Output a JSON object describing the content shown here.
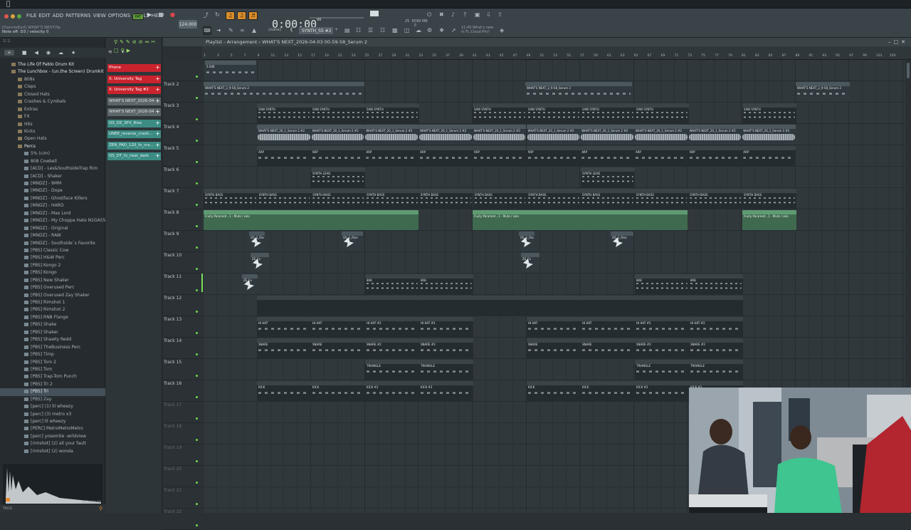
{
  "menu": [
    "FILE",
    "EDIT",
    "ADD",
    "PATTERNS",
    "VIEW",
    "OPTIONS",
    "TOOLS",
    "HELP"
  ],
  "hint": {
    "project": "[DannieEarl] WHAT'S NEXT.flp",
    "status": "Note off: D3 / velocity 0"
  },
  "transport": {
    "mode": "PAT",
    "tempo": "124.000",
    "time": "0:00:00",
    "time_small": "00"
  },
  "monitor": {
    "cpu": "25",
    "ram": "6599 MB",
    "voices": "0"
  },
  "pattern_selector": "SYNTH_SS #2",
  "snap": "(none)",
  "news": {
    "line1": "11:45 What's new",
    "line2": "in FL Cloud Pro?"
  },
  "playlist": {
    "title": "Playlist - Arrangement",
    "breadcrumb": "WHAT'S NEXT_2026-04-03 00-59-58_Serum 2"
  },
  "browser": {
    "items": [
      {
        "label": "The Life Of Pablo Drum Kit",
        "level": 0,
        "bold": true
      },
      {
        "label": "The Lunchbox - (un.the Screen) Drumkit",
        "level": 0,
        "bold": true
      },
      {
        "label": "808s",
        "level": 1
      },
      {
        "label": "Claps",
        "level": 1
      },
      {
        "label": "Closed Hats",
        "level": 1
      },
      {
        "label": "Crashes & Cymbals",
        "level": 1
      },
      {
        "label": "Extras",
        "level": 1
      },
      {
        "label": "FX",
        "level": 1
      },
      {
        "label": "Hits",
        "level": 1
      },
      {
        "label": "Kicks",
        "level": 1
      },
      {
        "label": "Open Hats",
        "level": 1
      },
      {
        "label": "Percs",
        "level": 1,
        "bold": true
      },
      {
        "label": "5% (cim)",
        "level": 2
      },
      {
        "label": "808 Cowbell",
        "level": 2
      },
      {
        "label": "[ACD] - Les&SouthsideTrap Rim",
        "level": 2
      },
      {
        "label": "[ACD] - Shaker",
        "level": 2
      },
      {
        "label": "[MNDZ] - 9MM",
        "level": 2
      },
      {
        "label": "[MNDZ] - Dope",
        "level": 2
      },
      {
        "label": "[MNDZ] - Ghostface Killers",
        "level": 2
      },
      {
        "label": "[MNDZ] - HARD",
        "level": 2
      },
      {
        "label": "[MNDZ] - Max Lord",
        "level": 2
      },
      {
        "label": "[MNDZ] - My Choppa Hate N1GA55",
        "level": 2
      },
      {
        "label": "[MNDZ] - Original",
        "level": 2
      },
      {
        "label": "[MNDZ] - RAW",
        "level": 2
      },
      {
        "label": "[MNDZ] - Southside`s Favorite",
        "level": 2
      },
      {
        "label": "[PBS] Classic Cow",
        "level": 2
      },
      {
        "label": "[PBS] H&W Perc",
        "level": 2
      },
      {
        "label": "[PBS] Kongo 2",
        "level": 2
      },
      {
        "label": "[PBS] Kongo",
        "level": 2
      },
      {
        "label": "[PBS] New Shaker",
        "level": 2
      },
      {
        "label": "[PBS] Overused Perc",
        "level": 2
      },
      {
        "label": "[PBS] Overused Zay Shaker",
        "level": 2
      },
      {
        "label": "[PBS] Rimshot 1",
        "level": 2
      },
      {
        "label": "[PBS] Rimshot 2",
        "level": 2
      },
      {
        "label": "[PBS] RNB Flange",
        "level": 2
      },
      {
        "label": "[PBS] Shake",
        "level": 2
      },
      {
        "label": "[PBS] Shaker",
        "level": 2
      },
      {
        "label": "[PBS] Shawty Redd",
        "level": 2
      },
      {
        "label": "[PBS] TheBusiness Perc",
        "level": 2
      },
      {
        "label": "[PBS] Timp",
        "level": 2
      },
      {
        "label": "[PBS] Tom 2",
        "level": 2
      },
      {
        "label": "[PBS] Tom",
        "level": 2
      },
      {
        "label": "[PBS] Trap-Tom Punch",
        "level": 2
      },
      {
        "label": "[PBS] Tri 2",
        "level": 2
      },
      {
        "label": "[PBS] Tri",
        "level": 2,
        "selected": true
      },
      {
        "label": "[PBS] Zay",
        "level": 2
      },
      {
        "label": "[perc] (1) lil wheezy",
        "level": 2
      },
      {
        "label": "[perc] (3) metro x3",
        "level": 2
      },
      {
        "label": "[perc] lil wheezy",
        "level": 2
      },
      {
        "label": "[PERC] MetroMetroMetro",
        "level": 2
      },
      {
        "label": "[perc] yosemite -wrldview",
        "level": 2
      },
      {
        "label": "[rimshot] (2) all your fault",
        "level": 2
      },
      {
        "label": "[rimshot] (2) wonda",
        "level": 2
      }
    ],
    "sample_info": "44.1 kHz 16",
    "tags": "TAGS"
  },
  "channels": [
    {
      "label": "Phone",
      "color": "red"
    },
    {
      "label": "X. University Tag",
      "color": "red"
    },
    {
      "label": "X. University Tag #2",
      "color": "red"
    },
    {
      "label": "WHAT'S NEXT_2026-04-0...",
      "color": "grey"
    },
    {
      "label": "WHAT'S NEXT_2026-04-0...",
      "color": "grey"
    },
    {
      "label": "OS_DZ_SFX_Rise",
      "color": "teal"
    },
    {
      "label": "UNEE_reverse_crash...",
      "color": "teal"
    },
    {
      "label": "ZEN_PAD_120_fx_cra...",
      "color": "teal"
    },
    {
      "label": "OS_DT_fx_riser_dark",
      "color": "teal"
    }
  ],
  "ruler": [
    "1",
    "3",
    "5",
    "7",
    "9",
    "11",
    "13",
    "15",
    "17",
    "19",
    "21",
    "23",
    "25",
    "27",
    "29",
    "31",
    "33",
    "35",
    "37",
    "39",
    "41",
    "43",
    "45",
    "47",
    "49",
    "51",
    "53",
    "55",
    "57",
    "59",
    "61",
    "63",
    "65",
    "67",
    "69",
    "71",
    "73",
    "75",
    "77",
    "79",
    "81",
    "83",
    "85",
    "87",
    "89",
    "91",
    "93",
    "95",
    "97",
    "99",
    "101",
    "103"
  ],
  "tracks": [
    "",
    "Track 2",
    "Track 3",
    "Track 4",
    "Track 5",
    "Track 6",
    "Track 7",
    "Track 8",
    "Track 9",
    "Track 10",
    "Track 11",
    "Track 12",
    "Track 13",
    "Track 14",
    "Track 15",
    "Track 16",
    "Track 17",
    "Track 18",
    "Track 19",
    "Track 20",
    "Track 21",
    "Track 22"
  ],
  "clips": {
    "t1": "5.048",
    "serum2": "WHAT'S NEXT_2_9-58_Serum 2",
    "saw": "SAW SYNTH",
    "serum2b": "WHAT'S NEXT_20_1_Serum 2 #2",
    "arp": "ARP",
    "lead": "SYNTH LEAD",
    "bass": "SYNTH BASS",
    "auto": "Fruity Parametr...1 - Mute / solo",
    "fx1": "OS_1_Rise",
    "fx2": "ZE_Fx",
    "o808": "808",
    "hh": "HI HAT",
    "hh2": "HI HAT #2",
    "snare": "SNARE",
    "snare2": "SNARE #2",
    "tri": "TRIANGLE",
    "kick": "KICK",
    "kick2": "KICK #2"
  }
}
